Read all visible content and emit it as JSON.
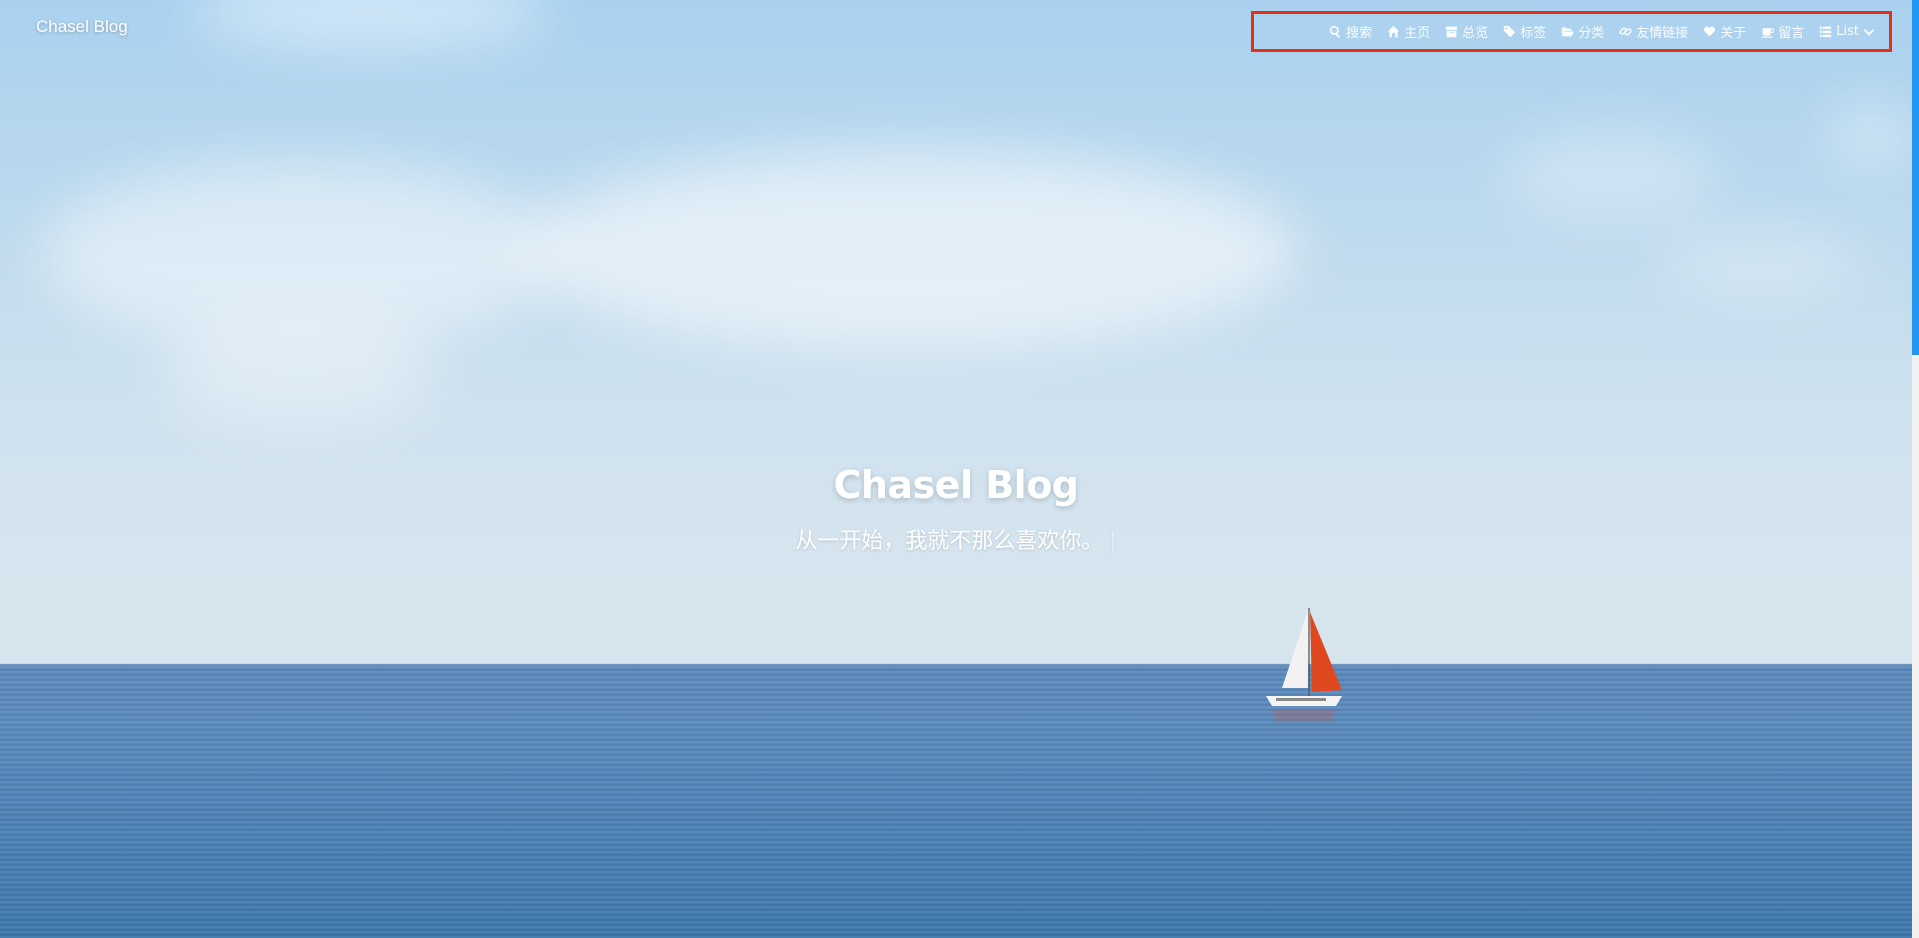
{
  "brand": "Chasel Blog",
  "nav": {
    "items": [
      {
        "icon": "search-icon",
        "label": "搜索"
      },
      {
        "icon": "home-icon",
        "label": "主页"
      },
      {
        "icon": "archive-icon",
        "label": "总览"
      },
      {
        "icon": "tags-icon",
        "label": "标签"
      },
      {
        "icon": "folder-open-icon",
        "label": "分类"
      },
      {
        "icon": "link-icon",
        "label": "友情链接"
      },
      {
        "icon": "heart-icon",
        "label": "关于"
      },
      {
        "icon": "coffee-icon",
        "label": "留言"
      },
      {
        "icon": "list-icon",
        "label": "List"
      }
    ],
    "highlight_color": "#e53018"
  },
  "hero": {
    "title": "Chasel Blog",
    "subtitle": "从一开始，我就不那么喜欢你。",
    "cursor": "|"
  },
  "colors": {
    "accent": "#2196f3",
    "sail": "#e0491f"
  }
}
